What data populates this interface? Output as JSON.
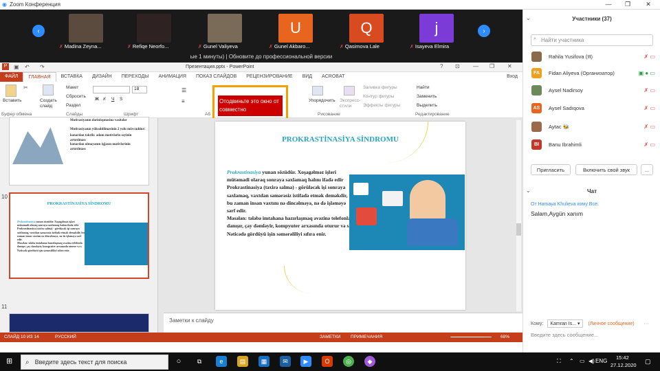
{
  "zoom": {
    "window_title": "Zoom Конференция",
    "update_text": "ые 1 минуты) | Обновите до профессиональной версии"
  },
  "gallery": [
    {
      "name": "Madina Zeyna...",
      "letter": "",
      "color": "#5b4a3e"
    },
    {
      "name": "Refiqe Neorfo...",
      "letter": "",
      "color": "#3a2a2a"
    },
    {
      "name": "Gunel Valiyeva",
      "letter": "",
      "color": "#6b5c4e"
    },
    {
      "name": "Gunel Akbaro...",
      "letter": "U",
      "color": "#e8651f"
    },
    {
      "name": "Qasimova Lale",
      "letter": "Q",
      "color": "#d84a1f"
    },
    {
      "name": "Isayeva Elmira",
      "letter": "j",
      "color": "#7a3bd6"
    }
  ],
  "powerpoint": {
    "doc_title": "Презентация.pptx - PowerPoint",
    "signin": "Вход",
    "tabs": [
      "ФАЙЛ",
      "ГЛАВНАЯ",
      "ВСТАВКА",
      "ДИЗАЙН",
      "ПЕРЕХОДЫ",
      "АНИМАЦИЯ",
      "ПОКАЗ СЛАЙДОВ",
      "РЕЦЕНЗИРОВАНИЕ",
      "ВИД",
      "ACROBAT"
    ],
    "ribbon": {
      "paste": "Вставить",
      "create_slide": "Создать слайд",
      "layout": "Макет",
      "reset": "Сбросить",
      "section": "Раздел",
      "arrange": "Упорядочить",
      "quick_styles": "Экспресс-стили",
      "shape_fill": "Заливка фигуры",
      "shape_outline": "Контур фигуры",
      "shape_effects": "Эффекты фигуры",
      "find": "Найти",
      "replace": "Заменить",
      "select": "Выделить",
      "groups": {
        "clipboard": "Буфер обмена",
        "slides": "Слайды",
        "font": "Шрифт",
        "paragraph": "Аб",
        "drawing": "Рисование",
        "editing": "Редактирование"
      },
      "font_size": "18"
    },
    "overlay_text": "Отодвиньте это окно от совместно",
    "thumbnail_9": {
      "heading": "Motivasiyanın dərinləşməsinə vasitələr",
      "sub": "Motivasiyanın yüksəldilməsinin 2 yolu mövcuddur:",
      "bullet1": "kənardan təkrik: adam motivlərin səyinin artırılması",
      "bullet2": "kənardan olmayanın işğasın motivlərinin artırılması"
    },
    "slide_numbers": [
      "10",
      "11"
    ],
    "slide": {
      "title": "PROKRASTİNASİYA SİNDROMU",
      "lead": "Prokrastinasiya",
      "p1": " yunan sözüdür. Xoşagəlməz işləri mütəmadi olaraq sonraya saxlamaq halını ifadə edir",
      "p2": "Prokrastinasiya (təxirə salma) - görüləcək işi sonraya saxlamaq, vaxtdan səmərəsiz istifadə etmək deməkdir, bu zaman insan vaxtını nə dincəlməyə, nə də işləməyə sərf edir.",
      "p3": "Məsələn: tələbə imtahana hazırlaşmaq əvəzinə telefonla danışır, çay dəmləyir, kompyuter arxasında oturur və s.",
      "p4": "Nəticədə gördüyü işin səmərəliliyi sıfıra enir."
    },
    "notes_placeholder": "Заметки к слайду",
    "status": {
      "slide": "СЛАЙД 10 ИЗ 14",
      "lang": "РУССКИЙ",
      "notes": "ЗАМЕТКИ",
      "comments": "ПРИМЕЧАНИЯ",
      "zoom": "68%"
    }
  },
  "sidebar": {
    "header": "Участники (37)",
    "search_placeholder": "Найти участника",
    "participants": [
      {
        "name": "Rahila Yusifova (Я)",
        "initials": "",
        "color": "#8a6a4a"
      },
      {
        "name": "Fidan Aliyeva (Организатор)",
        "initials": "FA",
        "color": "#f0a020"
      },
      {
        "name": "Aysel Nadirsoy",
        "initials": "",
        "color": "#6a8a5a"
      },
      {
        "name": "Aysel Sadıqova",
        "initials": "AS",
        "color": "#e8651f"
      },
      {
        "name": "Aytac 🐝",
        "initials": "",
        "color": "#9a6a4a"
      },
      {
        "name": "Banu Ibrahimli",
        "initials": "BI",
        "color": "#c0392b"
      }
    ],
    "invite": "Пригласить",
    "unmute": "Включить свой звук",
    "more": "...",
    "chat_header": "Чат",
    "chat_from": "От Hamaya Khulieva кому Все:",
    "chat_msg": "Salam,Aygün xanım",
    "chat_to_label": "Кому:",
    "chat_to_value": "Kamran Is... ▾",
    "chat_private": "(Личное сообщение)",
    "chat_input_placeholder": "Введите здесь сообщение..."
  },
  "taskbar": {
    "search_placeholder": "Введите здесь текст для поиска",
    "time": "15:42",
    "date": "27.12.2020",
    "lang": "ENG"
  }
}
